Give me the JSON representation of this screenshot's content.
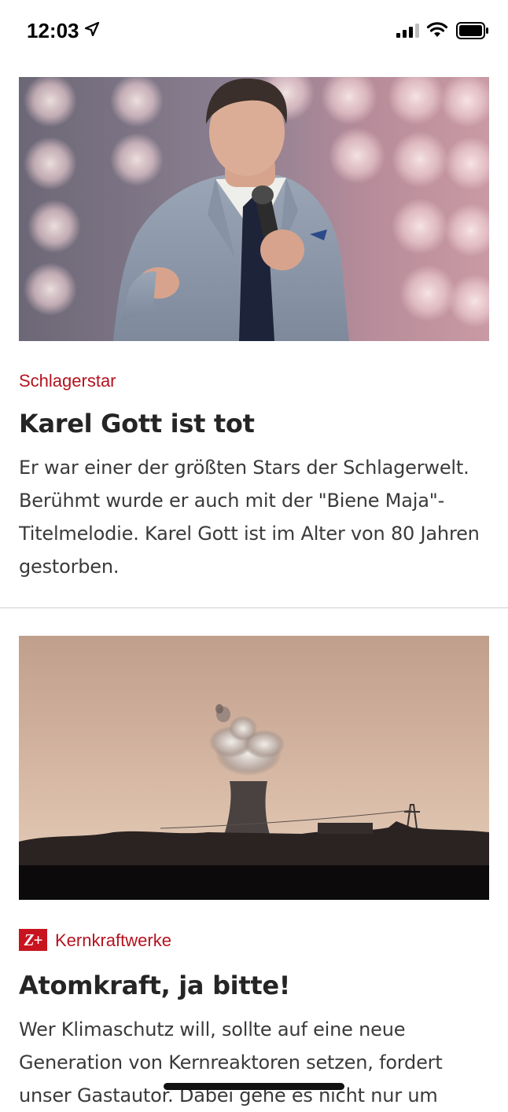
{
  "status_bar": {
    "time": "12:03"
  },
  "articles": [
    {
      "kicker": "Schlagerstar",
      "headline": "Karel Gott ist tot",
      "summary": "Er war einer der größten Stars der Schlagerwelt. Berühmt wurde er auch mit der \"Biene Maja\"-Titelmelodie. Karel Gott ist im Alter von 80 Jahren gestorben."
    },
    {
      "badge": "Z+",
      "kicker": "Kernkraftwerke",
      "headline": "Atomkraft, ja bitte!",
      "summary": "Wer Klimaschutz will, sollte auf eine neue Generation von Kernreaktoren setzen, fordert unser Gastautor. Dabei gehe es nicht nur um"
    }
  ],
  "colors": {
    "kicker": "#b4131e",
    "badge_bg": "#c8141e",
    "text": "#252525"
  },
  "icons": [
    "location-arrow-icon",
    "cellular-signal-icon",
    "wifi-icon",
    "battery-icon"
  ]
}
